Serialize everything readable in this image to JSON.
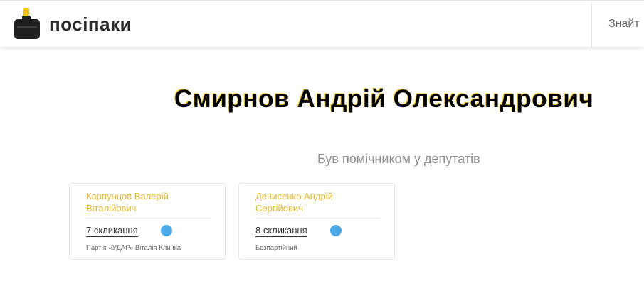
{
  "header": {
    "logo_text": "посіпаки",
    "search_label": "Знайт"
  },
  "person": {
    "name": "Смирнов Андрій Олександрович"
  },
  "assistant_section": {
    "title": "Був помічником у депутатів",
    "deputies": [
      {
        "name": "Карпунцов Валерій Віталійович",
        "convocation": "7 скликання",
        "party": "Партія «УДАР» Віталія Кличка"
      },
      {
        "name": "Денисенко Андрій Сергійович",
        "convocation": "8 скликання",
        "party": "Безпартійний"
      }
    ]
  },
  "colors": {
    "accent_yellow": "#f5c400",
    "deputy_name": "#e8b92a",
    "status_dot": "#4aa9e6",
    "section_title": "#8e8e8e"
  }
}
